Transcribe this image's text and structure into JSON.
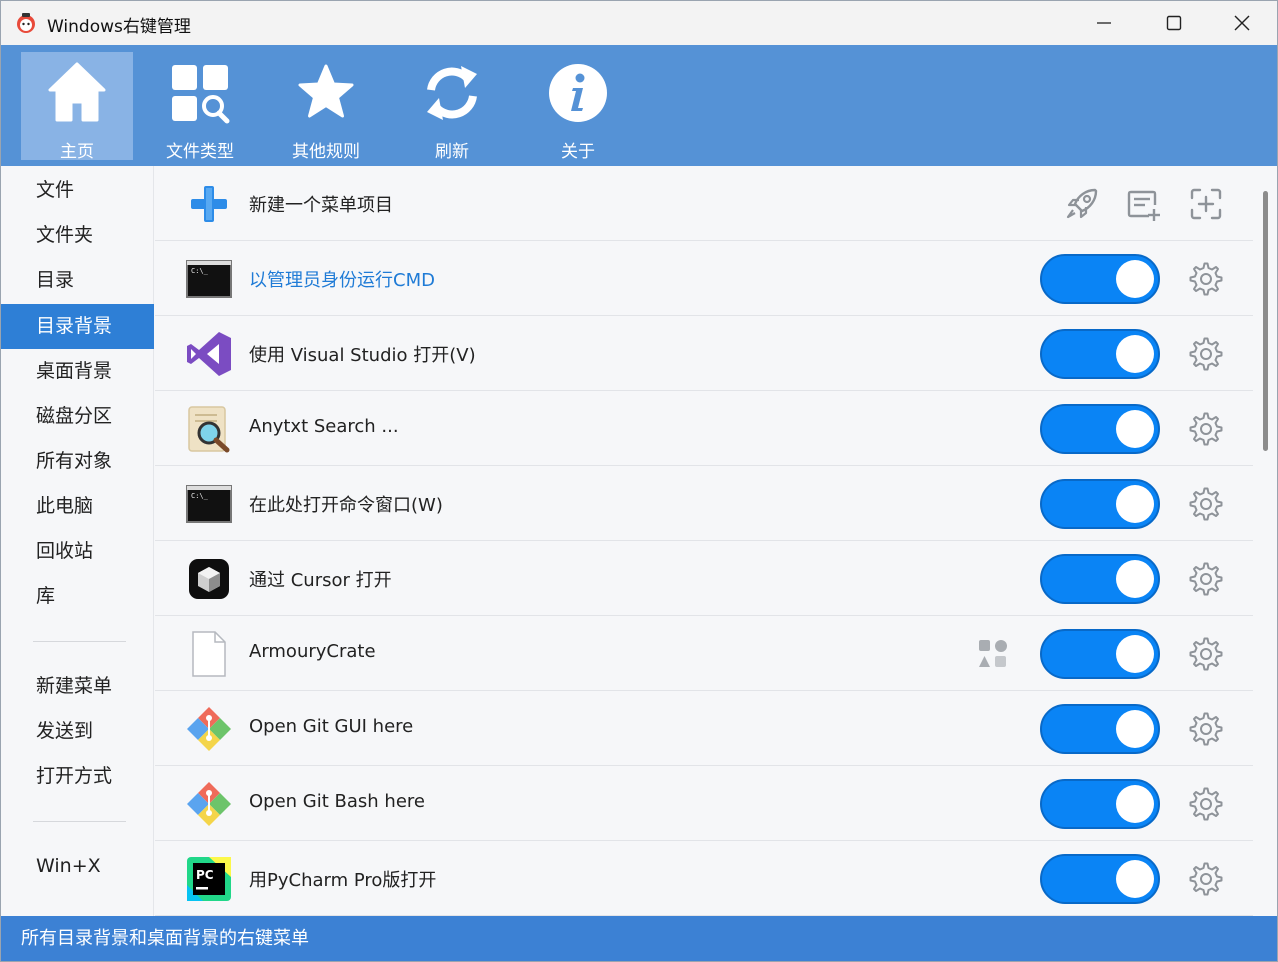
{
  "window": {
    "title": "Windows右键管理",
    "app_icon": "cartoon-app-icon"
  },
  "toolbar": {
    "items": [
      {
        "label": "主页",
        "icon": "home-icon",
        "active": true
      },
      {
        "label": "文件类型",
        "icon": "grid-search-icon",
        "active": false
      },
      {
        "label": "其他规则",
        "icon": "star-icon",
        "active": false
      },
      {
        "label": "刷新",
        "icon": "refresh-icon",
        "active": false
      },
      {
        "label": "关于",
        "icon": "info-icon",
        "active": false
      }
    ]
  },
  "sidebar": {
    "items": [
      {
        "label": "文件",
        "active": false
      },
      {
        "label": "文件夹",
        "active": false
      },
      {
        "label": "目录",
        "active": false
      },
      {
        "label": "目录背景",
        "active": true
      },
      {
        "label": "桌面背景",
        "active": false
      },
      {
        "label": "磁盘分区",
        "active": false
      },
      {
        "label": "所有对象",
        "active": false
      },
      {
        "label": "此电脑",
        "active": false
      },
      {
        "label": "回收站",
        "active": false
      },
      {
        "label": "库",
        "active": false
      }
    ],
    "group2": [
      {
        "label": "新建菜单"
      },
      {
        "label": "发送到"
      },
      {
        "label": "打开方式"
      }
    ],
    "group3": [
      {
        "label": "Win+X"
      }
    ]
  },
  "list": {
    "new_item": {
      "label": "新建一个菜单项目",
      "icon": "plus-icon"
    },
    "rows": [
      {
        "label": "以管理员身份运行CMD",
        "icon": "cmd-icon",
        "enabled": true,
        "highlight": true
      },
      {
        "label": "使用 Visual Studio 打开(V)",
        "icon": "visual-studio-icon",
        "enabled": true
      },
      {
        "label": "Anytxt Search ...",
        "icon": "anytxt-search-icon",
        "enabled": true
      },
      {
        "label": "在此处打开命令窗口(W)",
        "icon": "cmd-icon",
        "enabled": true
      },
      {
        "label": "通过 Cursor 打开",
        "icon": "cursor-app-icon",
        "enabled": true
      },
      {
        "label": "ArmouryCrate",
        "icon": "blank-file-icon",
        "enabled": true,
        "extra": "shapes-icon"
      },
      {
        "label": "Open Git GUI here",
        "icon": "git-icon",
        "enabled": true
      },
      {
        "label": "Open Git Bash here",
        "icon": "git-icon",
        "enabled": true
      },
      {
        "label": "用PyCharm Pro版打开",
        "icon": "pycharm-icon",
        "enabled": true
      }
    ]
  },
  "status": {
    "text": "所有目录背景和桌面背景的右键菜单"
  },
  "colors": {
    "toolbar_bg": "#5592d6",
    "accent": "#0a84f5",
    "sidebar_active": "#2e7fd6",
    "statusbar_bg": "#3c81d4"
  }
}
